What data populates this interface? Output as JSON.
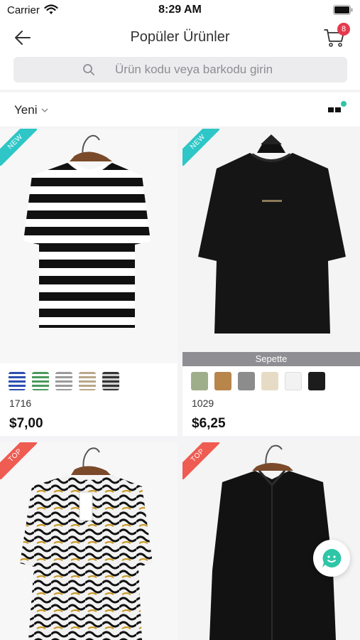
{
  "status_bar": {
    "carrier": "Carrier",
    "time": "8:29 AM"
  },
  "nav": {
    "title": "Popüler Ürünler",
    "cart_count": "8"
  },
  "search": {
    "placeholder": "Ürün kodu veya barkodu girin"
  },
  "sort": {
    "label": "Yeni"
  },
  "products": [
    {
      "badge": "NEW",
      "code": "1716",
      "price": "$7,00",
      "swatches": [
        "stripe-blue",
        "stripe-green",
        "stripe-grey",
        "stripe-beige",
        "stripe-dark"
      ]
    },
    {
      "badge": "NEW",
      "banner": "Sepette",
      "code": "1029",
      "price": "$6,25",
      "swatches": [
        "solid-sage",
        "solid-camel",
        "solid-grey",
        "solid-cream",
        "solid-white",
        "solid-black"
      ]
    },
    {
      "badge": "TOP"
    },
    {
      "badge": "TOP"
    }
  ],
  "colors": {
    "new_badge": "#2ec6c6",
    "top_badge": "#ef5c52",
    "cart_badge": "#e53a4e",
    "chat_accent": "#2ec6a6"
  }
}
